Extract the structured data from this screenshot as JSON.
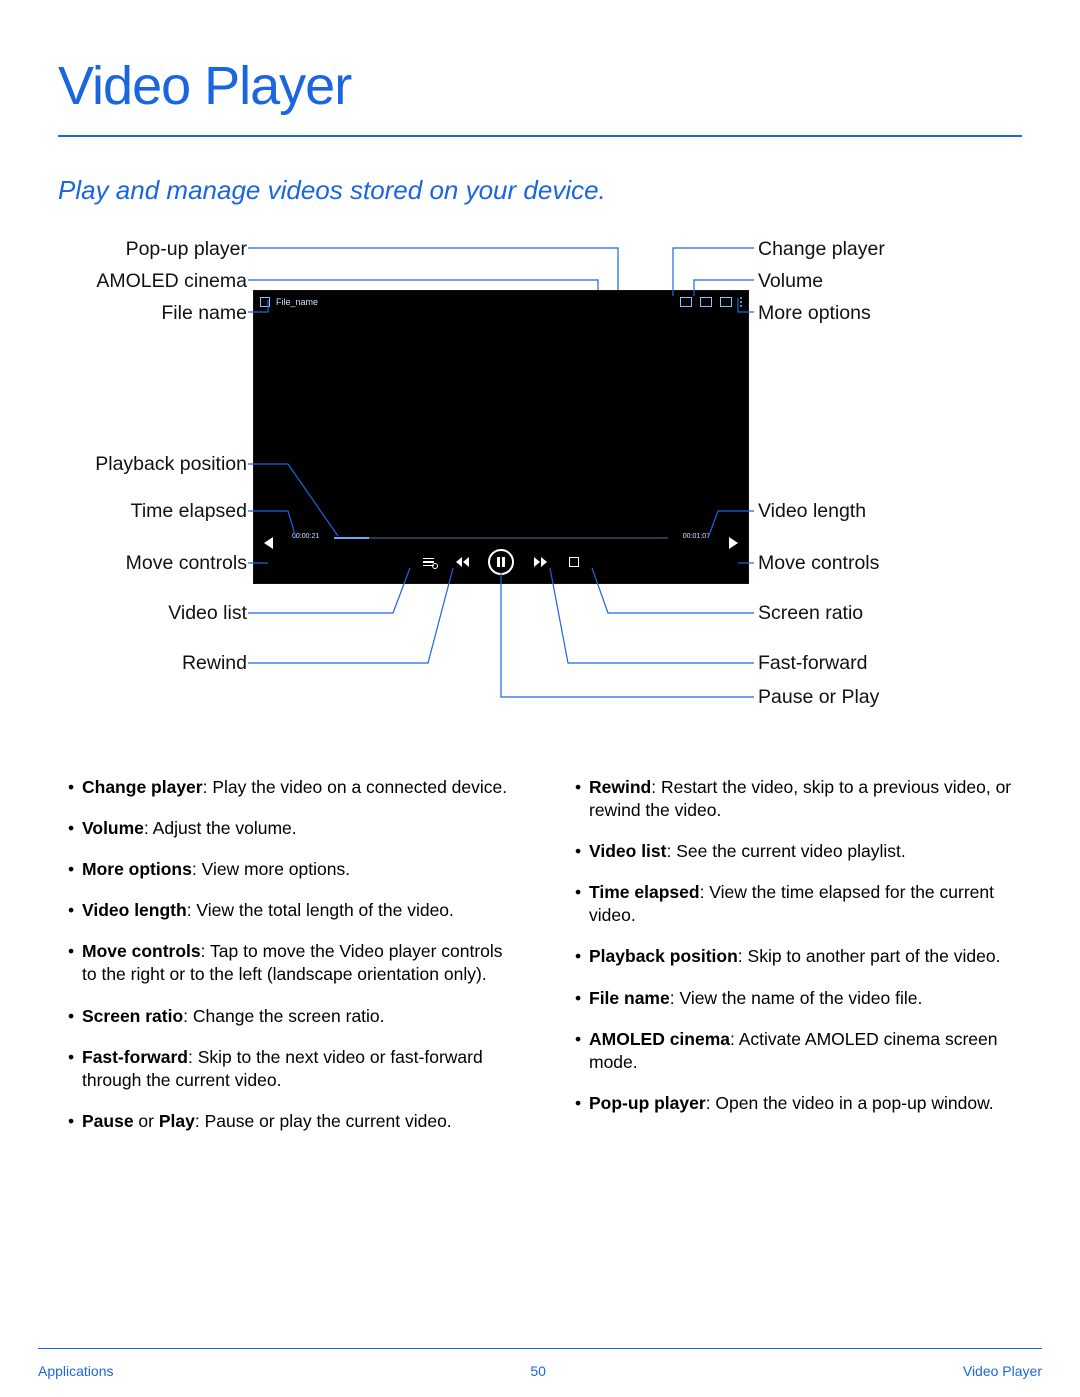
{
  "page": {
    "title": "Video Player",
    "intro": "Play and manage videos stored on your device.",
    "footer": {
      "left": "Applications",
      "center": "50",
      "right": "Video Player"
    }
  },
  "player": {
    "file_name_label": "File_name",
    "time_elapsed": "00:00:21",
    "video_length": "00:01:07"
  },
  "callouts": {
    "left": {
      "popup_player": "Pop-up player",
      "amoled_cinema": "AMOLED cinema",
      "file_name": "File name",
      "playback_position": "Playback position",
      "time_elapsed": "Time elapsed",
      "move_controls": "Move controls",
      "video_list": "Video list",
      "rewind": "Rewind"
    },
    "right": {
      "change_player": "Change player",
      "volume": "Volume",
      "more_options": "More options",
      "video_length": "Video length",
      "move_controls": "Move controls",
      "screen_ratio": "Screen ratio",
      "fast_forward": "Fast-forward",
      "pause_or_play": "Pause or Play"
    }
  },
  "descriptions": {
    "col1": [
      {
        "term": "Change player",
        "text": ": Play the video on a connected device."
      },
      {
        "term": "Volume",
        "text": ": Adjust the volume."
      },
      {
        "term": "More options",
        "text": ": View more options."
      },
      {
        "term": "Video length",
        "text": ": View the total length of the video."
      },
      {
        "term": "Move controls",
        "text": ": Tap to move the Video player controls to the right or to the left (landscape orientation only)."
      },
      {
        "term": "Screen ratio",
        "text": ": Change the screen ratio."
      },
      {
        "term": "Fast-forward",
        "text": ": Skip to the next video or fast-forward through the current video."
      },
      {
        "term": "Pause",
        "term2": "Play",
        "text_between": " or ",
        "text": ": Pause or play the current video."
      }
    ],
    "col2": [
      {
        "term": "Rewind",
        "text": ": Restart the video, skip to a previous video, or rewind the video."
      },
      {
        "term": "Video list",
        "text": ": See the current video playlist."
      },
      {
        "term": "Time elapsed",
        "text": ": View the time elapsed for the current video."
      },
      {
        "term": "Playback position",
        "text": ": Skip to another part of the video."
      },
      {
        "term": "File name",
        "text": ": View the name of the video file."
      },
      {
        "term": "AMOLED cinema",
        "text": ": Activate AMOLED cinema screen mode."
      },
      {
        "term": "Pop-up player",
        "text": ": Open the video in a pop-up window."
      }
    ]
  }
}
